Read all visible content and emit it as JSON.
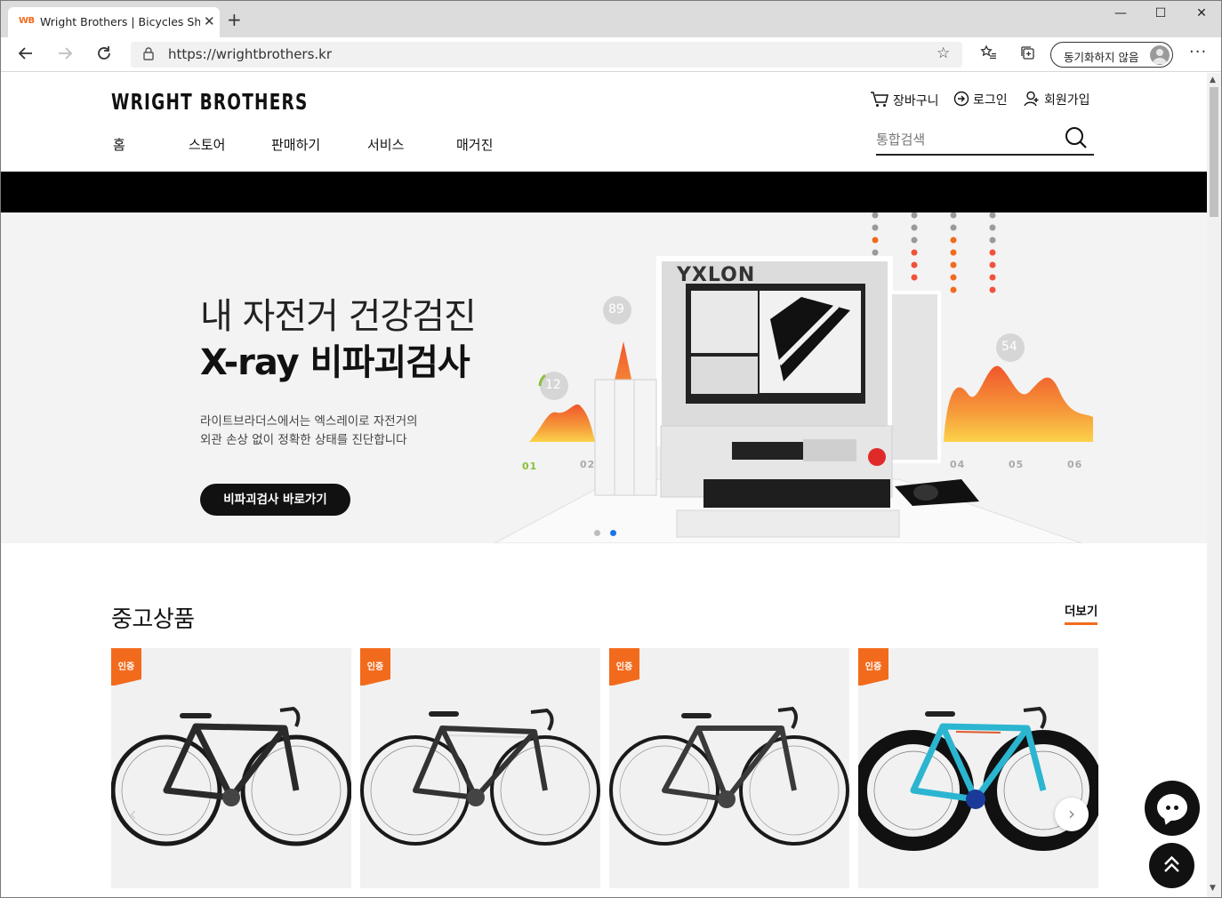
{
  "browser": {
    "tab_favicon": "WB",
    "tab_title": "Wright Brothers | Bicycles Shopp",
    "url": "https://wrightbrothers.kr",
    "sync_label": "동기화하지 않음",
    "icons": [
      "back-icon",
      "forward-icon",
      "refresh-icon",
      "lock-icon",
      "favorite-star-icon",
      "favorites-list-icon",
      "collections-icon",
      "more-icon"
    ]
  },
  "header": {
    "logo": "WRIGHT BROTHERS",
    "menu": [
      {
        "label": "홈"
      },
      {
        "label": "스토어"
      },
      {
        "label": "판매하기"
      },
      {
        "label": "서비스"
      },
      {
        "label": "매거진"
      }
    ],
    "utils": {
      "cart": "장바구니",
      "login": "로그인",
      "join": "회원가입"
    },
    "search_placeholder": "통합검색"
  },
  "hero": {
    "title_line1": "내 자전거 건강검진",
    "title_line2": "X-ray 비파괴검사",
    "desc_line1": "라이트브라더스에서는 엑스레이로 자전거의",
    "desc_line2": "외관 손상 없이 정확한 상태를 진단합니다",
    "button": "비파괴검사 바로가기",
    "machine_brand": "YXLON",
    "chart_badges": [
      "12",
      "89",
      "54"
    ],
    "chart_axis": [
      "01",
      "02",
      "04",
      "05",
      "06"
    ],
    "slide_count": 2,
    "active_slide": 2
  },
  "used_products": {
    "title": "중고상품",
    "more": "더보기",
    "badge": "인증",
    "items": [
      {
        "frame": "#2a2a2a",
        "accent": "#555555"
      },
      {
        "frame": "#333333",
        "accent": "#dddddd"
      },
      {
        "frame": "#3a3a3a",
        "accent": "#777777"
      },
      {
        "frame": "#2bb5d0",
        "accent": "#111111"
      }
    ]
  },
  "colors": {
    "accent": "#f26b1d",
    "dark": "#111111",
    "dot_active": "#1a73e8"
  }
}
